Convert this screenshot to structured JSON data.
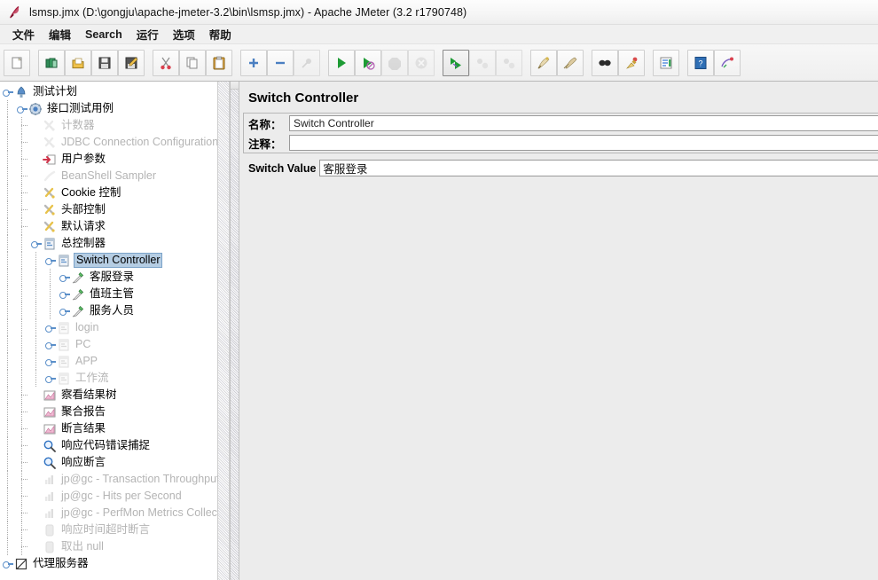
{
  "window": {
    "title": "lsmsp.jmx (D:\\gongju\\apache-jmeter-3.2\\bin\\lsmsp.jmx) - Apache JMeter (3.2 r1790748)",
    "icon": "jmeter-feather-icon"
  },
  "menubar": {
    "items": [
      {
        "label": "文件",
        "name": "menu-file"
      },
      {
        "label": "编辑",
        "name": "menu-edit"
      },
      {
        "label": "Search",
        "name": "menu-search"
      },
      {
        "label": "运行",
        "name": "menu-run"
      },
      {
        "label": "选项",
        "name": "menu-options"
      },
      {
        "label": "帮助",
        "name": "menu-help"
      }
    ]
  },
  "toolbar": {
    "buttons": [
      {
        "name": "new-icon",
        "enabled": true,
        "selected": false
      },
      {
        "name": "templates-icon",
        "enabled": true,
        "selected": false
      },
      {
        "name": "open-icon",
        "enabled": true,
        "selected": false
      },
      {
        "name": "save-icon",
        "enabled": true,
        "selected": false
      },
      {
        "name": "save-as-icon",
        "enabled": true,
        "selected": false
      },
      {
        "name": "cut-icon",
        "enabled": true,
        "selected": false
      },
      {
        "name": "copy-icon",
        "enabled": true,
        "selected": false
      },
      {
        "name": "paste-icon",
        "enabled": true,
        "selected": false
      },
      {
        "name": "expand-all-icon",
        "enabled": true,
        "selected": false
      },
      {
        "name": "collapse-all-icon",
        "enabled": true,
        "selected": false
      },
      {
        "name": "toggle-icon",
        "enabled": false,
        "selected": false
      },
      {
        "name": "start-icon",
        "enabled": true,
        "selected": false
      },
      {
        "name": "start-no-pauses-icon",
        "enabled": true,
        "selected": false
      },
      {
        "name": "stop-icon",
        "enabled": false,
        "selected": false
      },
      {
        "name": "shutdown-icon",
        "enabled": false,
        "selected": false
      },
      {
        "name": "remote-start-all-icon",
        "enabled": true,
        "selected": true
      },
      {
        "name": "remote-stop-all-icon",
        "enabled": false,
        "selected": false
      },
      {
        "name": "remote-shutdown-all-icon",
        "enabled": false,
        "selected": false
      },
      {
        "name": "clear-icon",
        "enabled": true,
        "selected": false
      },
      {
        "name": "clear-all-icon",
        "enabled": true,
        "selected": false
      },
      {
        "name": "search-icon",
        "enabled": true,
        "selected": false
      },
      {
        "name": "search-reset-icon",
        "enabled": true,
        "selected": false
      },
      {
        "name": "function-helper-icon",
        "enabled": true,
        "selected": false
      },
      {
        "name": "help-icon",
        "enabled": true,
        "selected": false
      },
      {
        "name": "undo-redo-icon",
        "enabled": true,
        "selected": false
      }
    ]
  },
  "tree": {
    "nodes": [
      {
        "label": "测试计划",
        "icon": "test-plan-icon",
        "depth": 0,
        "handle": "expanded",
        "muted": false,
        "selected": false
      },
      {
        "label": "接口测试用例",
        "icon": "thread-group-icon",
        "depth": 1,
        "handle": "expanded",
        "muted": false,
        "selected": false
      },
      {
        "label": "计数器",
        "icon": "config-icon",
        "depth": 2,
        "handle": "none",
        "muted": true,
        "selected": false
      },
      {
        "label": "JDBC Connection Configuration",
        "icon": "config-icon",
        "depth": 2,
        "handle": "none",
        "muted": true,
        "selected": false
      },
      {
        "label": "用户参数",
        "icon": "user-params-icon",
        "depth": 2,
        "handle": "none",
        "muted": false,
        "selected": false
      },
      {
        "label": "BeanShell Sampler",
        "icon": "beanshell-icon",
        "depth": 2,
        "handle": "none",
        "muted": true,
        "selected": false
      },
      {
        "label": "Cookie 控制",
        "icon": "config-icon",
        "depth": 2,
        "handle": "none",
        "muted": false,
        "selected": false
      },
      {
        "label": "头部控制",
        "icon": "config-icon",
        "depth": 2,
        "handle": "none",
        "muted": false,
        "selected": false
      },
      {
        "label": "默认请求",
        "icon": "config-icon",
        "depth": 2,
        "handle": "none",
        "muted": false,
        "selected": false
      },
      {
        "label": "总控制器",
        "icon": "controller-icon",
        "depth": 2,
        "handle": "expanded",
        "muted": false,
        "selected": false
      },
      {
        "label": "Switch Controller",
        "icon": "controller-icon",
        "depth": 3,
        "handle": "expanded",
        "muted": false,
        "selected": true
      },
      {
        "label": "客服登录",
        "icon": "sampler-icon",
        "depth": 4,
        "handle": "collapsed",
        "muted": false,
        "selected": false
      },
      {
        "label": "值班主管",
        "icon": "sampler-icon",
        "depth": 4,
        "handle": "collapsed",
        "muted": false,
        "selected": false
      },
      {
        "label": "服务人员",
        "icon": "sampler-icon",
        "depth": 4,
        "handle": "collapsed",
        "muted": false,
        "selected": false
      },
      {
        "label": "login",
        "icon": "controller-icon",
        "depth": 3,
        "handle": "collapsed",
        "muted": true,
        "selected": false
      },
      {
        "label": "PC",
        "icon": "controller-icon",
        "depth": 3,
        "handle": "collapsed",
        "muted": true,
        "selected": false
      },
      {
        "label": "APP",
        "icon": "controller-icon",
        "depth": 3,
        "handle": "collapsed",
        "muted": true,
        "selected": false
      },
      {
        "label": "工作流",
        "icon": "controller-icon",
        "depth": 3,
        "handle": "collapsed",
        "muted": true,
        "selected": false
      },
      {
        "label": "察看结果树",
        "icon": "listener-icon",
        "depth": 2,
        "handle": "none",
        "muted": false,
        "selected": false
      },
      {
        "label": "聚合报告",
        "icon": "listener-icon",
        "depth": 2,
        "handle": "none",
        "muted": false,
        "selected": false
      },
      {
        "label": "断言结果",
        "icon": "listener-icon",
        "depth": 2,
        "handle": "none",
        "muted": false,
        "selected": false
      },
      {
        "label": "响应代码错误捕捉",
        "icon": "assertion-icon",
        "depth": 2,
        "handle": "none",
        "muted": false,
        "selected": false
      },
      {
        "label": "响应断言",
        "icon": "assertion-icon",
        "depth": 2,
        "handle": "none",
        "muted": false,
        "selected": false
      },
      {
        "label": "jp@gc - Transaction Throughput vs Threads",
        "icon": "plugin-listener-icon",
        "depth": 2,
        "handle": "none",
        "muted": true,
        "selected": false
      },
      {
        "label": "jp@gc - Hits per Second",
        "icon": "plugin-listener-icon",
        "depth": 2,
        "handle": "none",
        "muted": true,
        "selected": false
      },
      {
        "label": "jp@gc - PerfMon Metrics Collector",
        "icon": "plugin-listener-icon",
        "depth": 2,
        "handle": "none",
        "muted": true,
        "selected": false
      },
      {
        "label": "响应时间超时断言",
        "icon": "timer-icon",
        "depth": 2,
        "handle": "none",
        "muted": true,
        "selected": false
      },
      {
        "label": "取出 null",
        "icon": "timer-icon",
        "depth": 2,
        "handle": "none",
        "muted": true,
        "selected": false
      },
      {
        "label": "代理服务器",
        "icon": "proxy-icon",
        "depth": 0,
        "handle": "collapsed",
        "muted": false,
        "selected": false
      }
    ]
  },
  "panel": {
    "title": "Switch Controller",
    "name_label": "名称：",
    "name_value": "Switch Controller",
    "comment_label": "注释：",
    "comment_value": "",
    "switch_label": "Switch Value",
    "switch_value": "客服登录"
  },
  "colors": {
    "selection_bg": "#b5cde3",
    "selection_border": "#7ba3c9",
    "panel_bg": "#ececec",
    "tree_bg": "#ffffff",
    "muted_text": "#b4b4b4",
    "toolbar_bg": "#f2f2f2"
  }
}
